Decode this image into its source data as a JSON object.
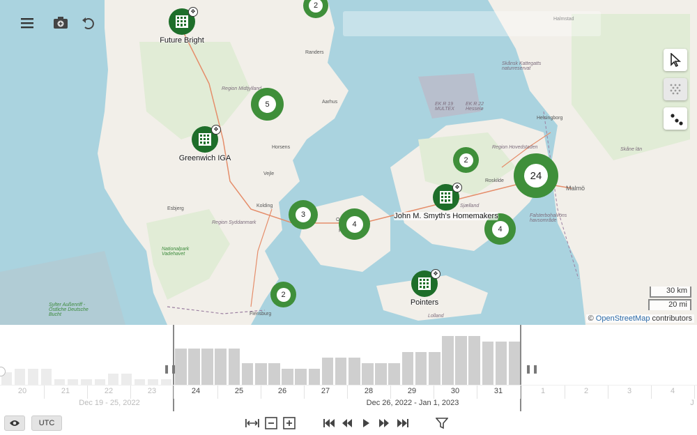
{
  "map": {
    "regions": [
      "Region Midtjylland",
      "Region Syddanmark",
      "Region Hovedstaden",
      "Skåne län"
    ],
    "cities": [
      "Randers",
      "Aarhus",
      "Horsens",
      "Vejle",
      "Kolding",
      "Esbjerg",
      "Odense",
      "Fyn",
      "Roskilde",
      "Helsingborg",
      "Malmö",
      "Sjælland",
      "Lolland",
      "Flensburg",
      "Halmstad"
    ],
    "areas": [
      "EK R 19 MULTEX",
      "EK R 22 Hesselø",
      "Skånsk Kattegatts naturreservat",
      "Falsterbohalvö­ns havsområde",
      "Nationalpark Vadehavet",
      "Sylter Außenriff - Östliche Deutsche Bucht"
    ],
    "clusters": [
      {
        "count": "2"
      },
      {
        "count": "5"
      },
      {
        "count": "2"
      },
      {
        "count": "24"
      },
      {
        "count": "3"
      },
      {
        "count": "4"
      },
      {
        "count": "4"
      },
      {
        "count": "2"
      }
    ],
    "places": [
      {
        "name": "Future Bright"
      },
      {
        "name": "Greenwich IGA"
      },
      {
        "name": "John M. Smyth's Homemakers"
      },
      {
        "name": "Pointers"
      }
    ],
    "scale": {
      "km": "30 km",
      "mi": "20 mi"
    },
    "attribution": {
      "prefix": "©",
      "link": "OpenStreetMap",
      "suffix": "contributors"
    }
  },
  "timeline": {
    "prev_days": [
      "20",
      "21",
      "22",
      "23"
    ],
    "days": [
      "24",
      "25",
      "26",
      "27",
      "28",
      "29",
      "30",
      "31"
    ],
    "next_days": [
      "1",
      "2",
      "3",
      "4"
    ],
    "prev_week": "Dec 19 - 25, 2022",
    "week": "Dec 26, 2022 - Jan 1, 2023",
    "next_week_partial": "J",
    "bars_prev": [
      0.35,
      0.45,
      0.45,
      0.45,
      0.15,
      0.15,
      0.15,
      0.15,
      0.3,
      0.3,
      0.15,
      0.15,
      0.15
    ],
    "bars": [
      1.0,
      1.0,
      1.0,
      1.0,
      1.0,
      0.6,
      0.6,
      0.6,
      0.45,
      0.45,
      0.45,
      0.75,
      0.75,
      0.75,
      0.6,
      0.6,
      0.6,
      0.9,
      0.9,
      0.9,
      1.35,
      1.35,
      1.35,
      1.2,
      1.2,
      1.2
    ]
  },
  "controls": {
    "eye_icon": "eye-icon",
    "utc": "UTC"
  },
  "colors": {
    "cluster": "#3f8f3a",
    "poi": "#1e6e2a",
    "water": "#aad3df",
    "land": "#f2efe9"
  }
}
